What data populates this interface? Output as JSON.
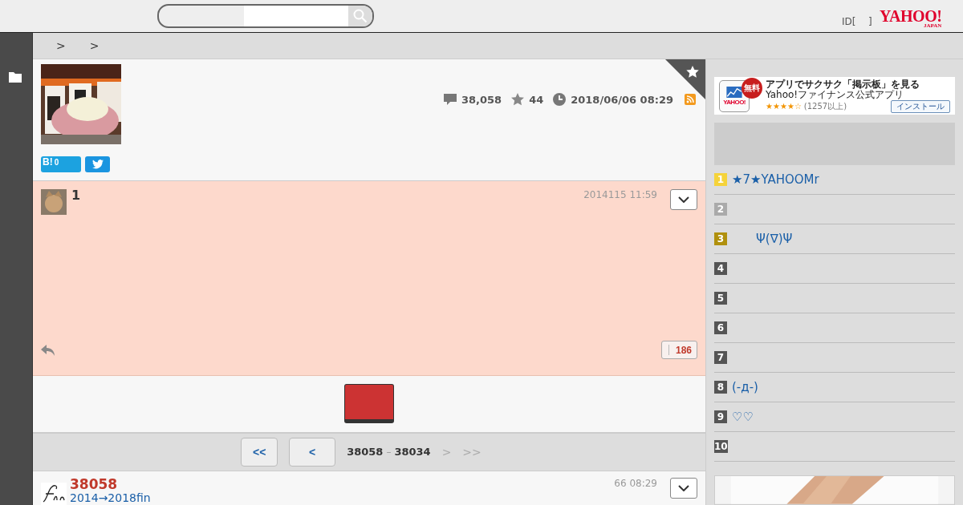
{
  "header": {
    "id_text": "ID[",
    "id_close": "]",
    "logo": {
      "main": "YAHOO!",
      "sub": "JAPAN"
    }
  },
  "breadcrumb": [
    ">",
    ">"
  ],
  "thread": {
    "kind": "picture",
    "bookmarked": true,
    "comments": "38,058",
    "stars": "44",
    "updated": "2018/06/06 08:29",
    "hatena": {
      "label": "B!",
      "count": "0"
    }
  },
  "comment": {
    "number": "1",
    "date": "2014115 11:59",
    "likes": "186"
  },
  "pager": {
    "first": "<<",
    "prev": "<",
    "from": "38058",
    "dash": "–",
    "to": "38034",
    "next": {
      "label": ">",
      "disabled": true
    },
    "last": {
      "label": ">>",
      "disabled": true
    }
  },
  "latest": {
    "number": "38058",
    "title": "2014→2018fin",
    "date": "66 08:29"
  },
  "ad": {
    "badge": "無料",
    "icon_text": "YAHOO!",
    "title": "アプリでサクサク「掲示板」を見る",
    "subtitle": "Yahoo!ファイナンス公式アプリ",
    "stars": 4,
    "reviews": "(1257以上)",
    "button": "インストール"
  },
  "ranking": [
    {
      "rank": "1",
      "color": "#f5d33a",
      "title": "★7★YAHOOMr"
    },
    {
      "rank": "2",
      "color": "#aaaaaa"
    },
    {
      "rank": "3",
      "color": "#b0900d",
      "title": "　　Ψ(∇)Ψ"
    },
    {
      "rank": "4",
      "color": "#555555"
    },
    {
      "rank": "5",
      "color": "#555555"
    },
    {
      "rank": "6",
      "color": "#555555"
    },
    {
      "rank": "7",
      "color": "#555555"
    },
    {
      "rank": "8",
      "color": "#555555",
      "title": "(-д-)"
    },
    {
      "rank": "9",
      "color": "#555555",
      "title": "♡♡"
    },
    {
      "rank": "10",
      "color": "#555555"
    }
  ]
}
